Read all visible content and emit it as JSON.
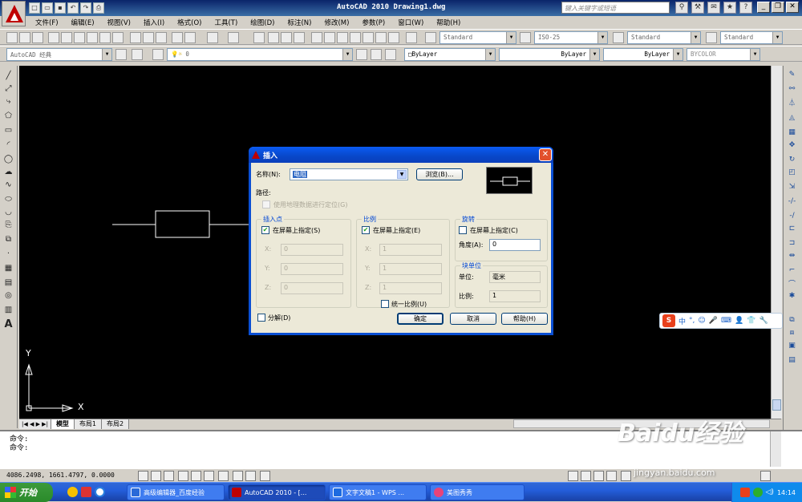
{
  "window": {
    "title": "AutoCAD 2010   Drawing1.dwg",
    "search_placeholder": "键入关键字或短语"
  },
  "menu": [
    "文件(F)",
    "编辑(E)",
    "视图(V)",
    "插入(I)",
    "格式(O)",
    "工具(T)",
    "绘图(D)",
    "标注(N)",
    "修改(M)",
    "参数(P)",
    "窗口(W)",
    "帮助(H)"
  ],
  "toolbar": {
    "text_style": "Standard",
    "dim_style": "ISO-25",
    "table_style": "Standard",
    "multileader_style": "Standard",
    "workspace": "AutoCAD 经典",
    "layer": "0",
    "color": "ByLayer",
    "linetype": "ByLayer",
    "lineweight": "ByLayer",
    "plotstyle": "BYCOLOR"
  },
  "dialog": {
    "title": "插入",
    "name_label": "名称(N):",
    "name_value": "电阻",
    "browse_label": "浏览(B)...",
    "path_label": "路径:",
    "geo_label": "使用地理数据进行定位(G)",
    "insertion": {
      "title": "插入点",
      "on_screen": "在屏幕上指定(S)",
      "on_screen_checked": true,
      "x_label": "X:",
      "y_label": "Y:",
      "z_label": "Z:",
      "x": "0",
      "y": "0",
      "z": "0"
    },
    "scale": {
      "title": "比例",
      "on_screen": "在屏幕上指定(E)",
      "on_screen_checked": true,
      "x_label": "X:",
      "y_label": "Y:",
      "z_label": "Z:",
      "x": "1",
      "y": "1",
      "z": "1",
      "uniform": "统一比例(U)"
    },
    "rotation": {
      "title": "旋转",
      "on_screen": "在屏幕上指定(C)",
      "angle_label": "角度(A):",
      "angle": "0"
    },
    "block_unit": {
      "title": "块单位",
      "unit_label": "单位:",
      "unit": "毫米",
      "factor_label": "比例:",
      "factor": "1"
    },
    "explode": "分解(D)",
    "ok": "确定",
    "cancel": "取消",
    "help": "帮助(H)"
  },
  "layout_tabs": [
    "模型",
    "布局1",
    "布局2"
  ],
  "ucs": {
    "x": "X",
    "y": "Y"
  },
  "command_lines": [
    "命令:",
    "命令:"
  ],
  "coordinates": "4086.2498, 1661.4797, 0.0000",
  "ime": {
    "logo": "S",
    "lang": "中"
  },
  "taskbar": {
    "start": "开始",
    "tasks": [
      "高级编辑器_百度经验",
      "AutoCAD 2010 - [...",
      "文字文稿1 - WPS ...",
      "美图秀秀"
    ],
    "clock": "14:14"
  },
  "watermark": {
    "brand": "Baidu经验",
    "url": "jingyan.baidu.com"
  }
}
